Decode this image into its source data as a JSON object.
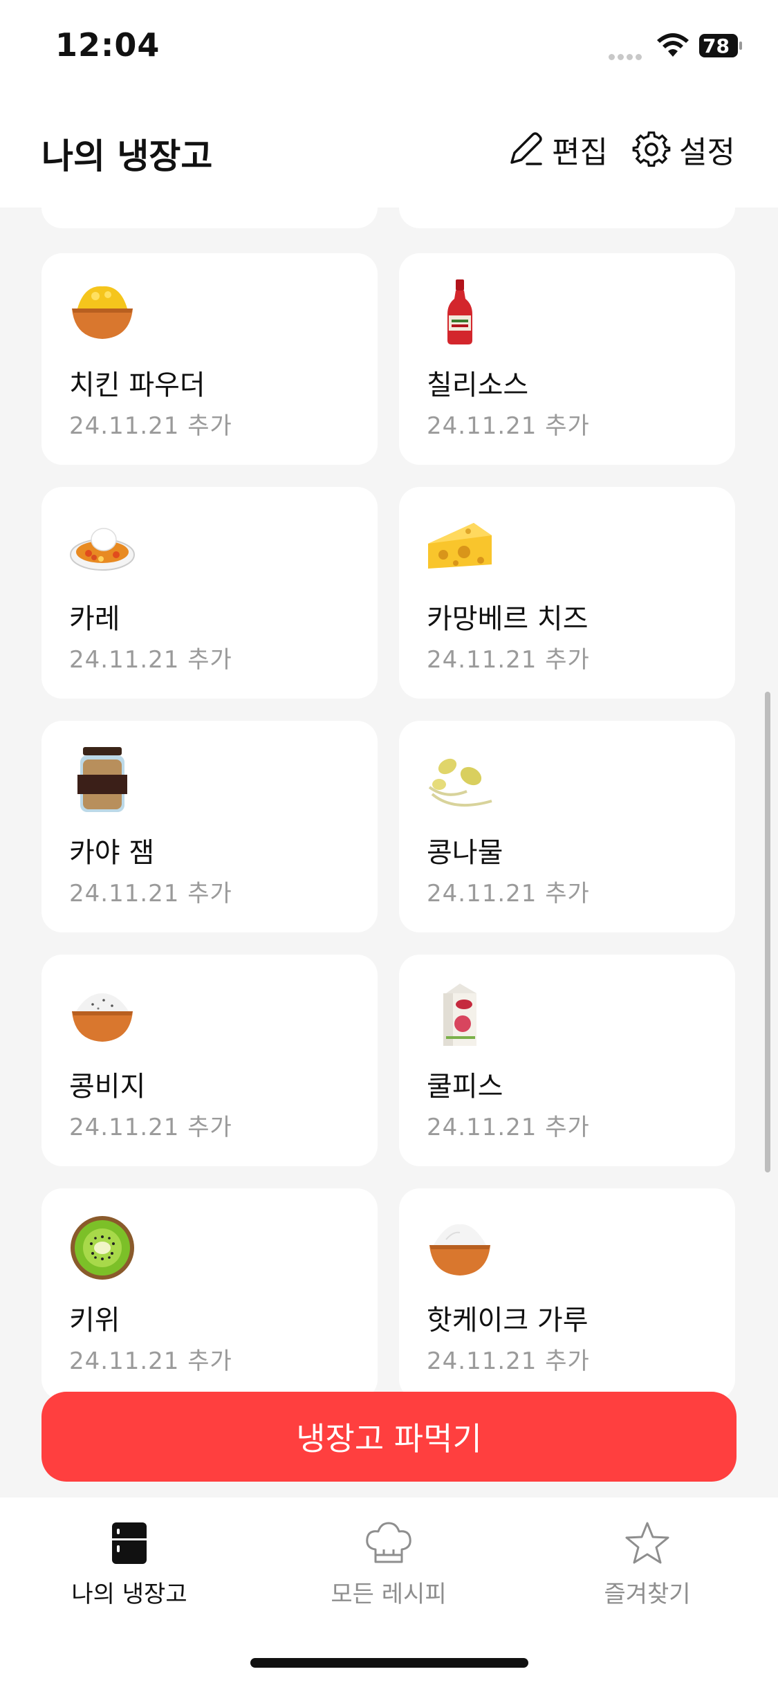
{
  "status_bar": {
    "time": "12:04",
    "battery": "78"
  },
  "header": {
    "title": "나의 냉장고",
    "edit_label": "편집",
    "settings_label": "설정"
  },
  "items": [
    {
      "name": "치킨 파우더",
      "date": "24.11.21  추가",
      "icon": "powder-bowl-yellow-icon"
    },
    {
      "name": "칠리소스",
      "date": "24.11.21  추가",
      "icon": "chili-sauce-bottle-icon"
    },
    {
      "name": "카레",
      "date": "24.11.21  추가",
      "icon": "curry-rice-icon"
    },
    {
      "name": "카망베르 치즈",
      "date": "24.11.21  추가",
      "icon": "cheese-wedge-icon"
    },
    {
      "name": "카야 잼",
      "date": "24.11.21  추가",
      "icon": "jam-jar-icon"
    },
    {
      "name": "콩나물",
      "date": "24.11.21  추가",
      "icon": "bean-sprouts-icon"
    },
    {
      "name": "콩비지",
      "date": "24.11.21  추가",
      "icon": "powder-bowl-white-icon"
    },
    {
      "name": "쿨피스",
      "date": "24.11.21  추가",
      "icon": "juice-carton-icon"
    },
    {
      "name": "키위",
      "date": "24.11.21  추가",
      "icon": "kiwi-icon"
    },
    {
      "name": "핫케이크 가루",
      "date": "24.11.21  추가",
      "icon": "flour-bowl-icon"
    }
  ],
  "cta_label": "냉장고 파먹기",
  "tabs": [
    {
      "label": "나의 냉장고",
      "icon": "fridge-icon",
      "active": true
    },
    {
      "label": "모든 레시피",
      "icon": "chef-hat-icon",
      "active": false
    },
    {
      "label": "즐겨찾기",
      "icon": "star-icon",
      "active": false
    }
  ],
  "colors": {
    "accent": "#ff3f3f",
    "background": "#f5f5f5",
    "card": "#ffffff",
    "muted_text": "#9a9a9a"
  }
}
